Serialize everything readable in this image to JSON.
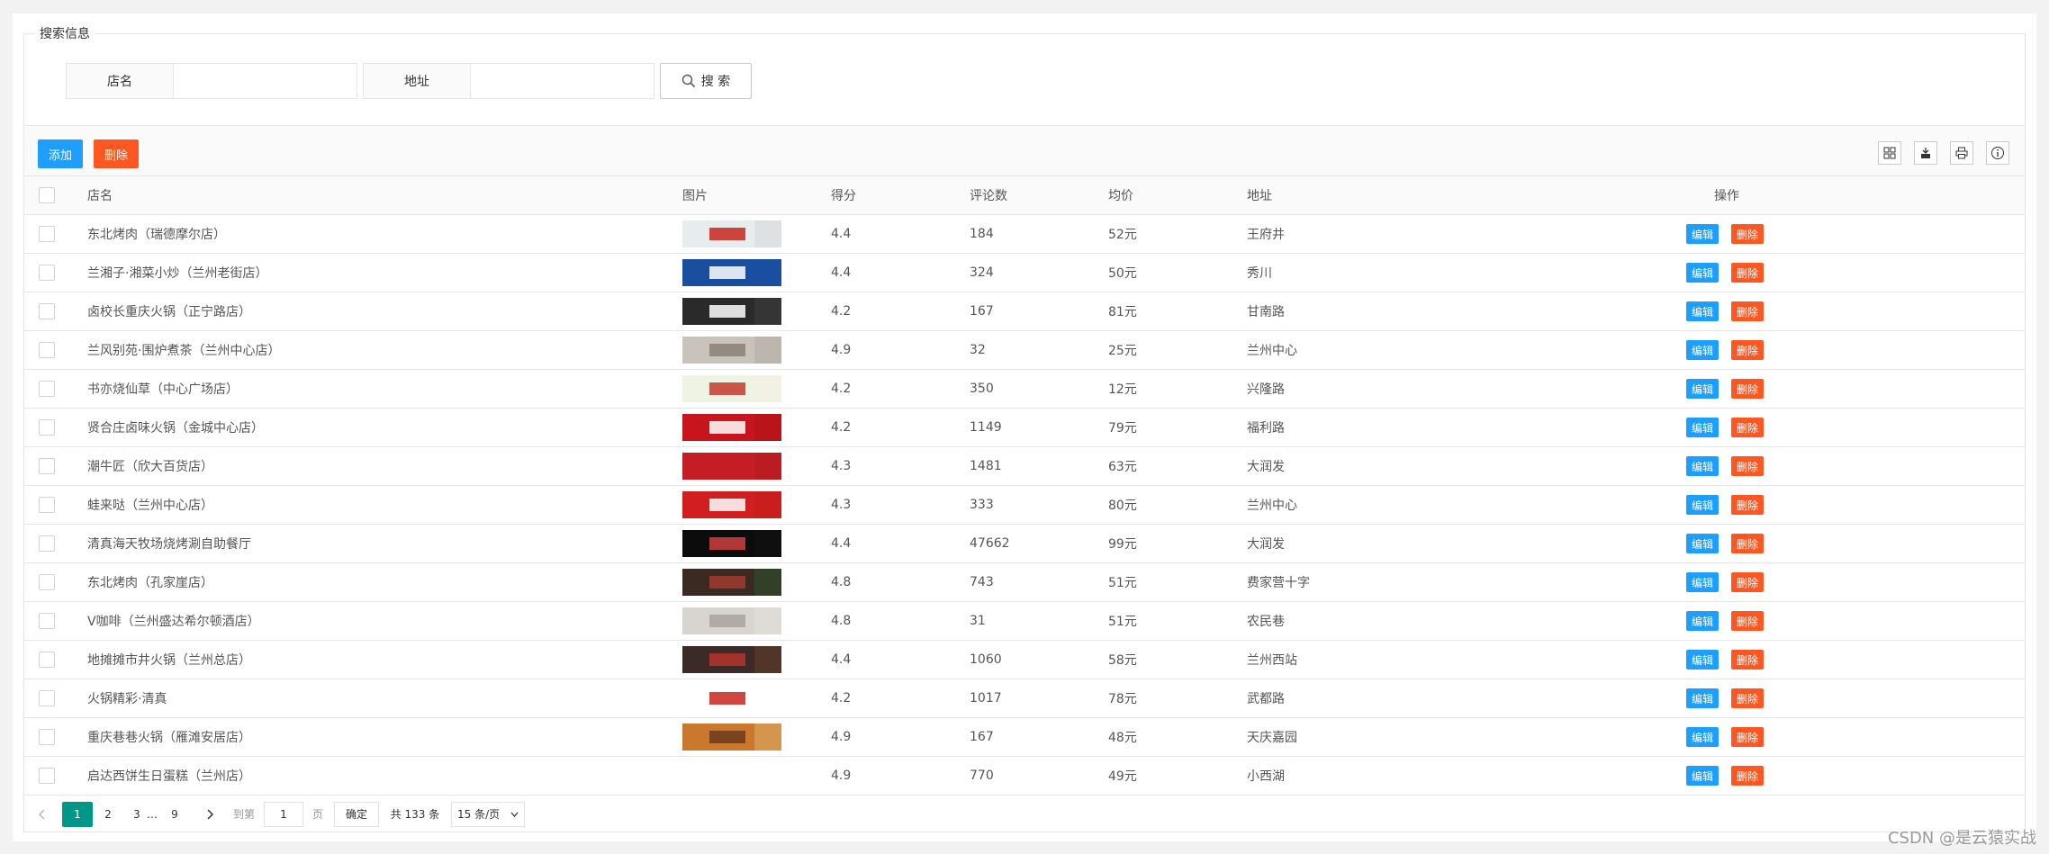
{
  "search": {
    "legend": "搜索信息",
    "name_label": "店名",
    "name_value": "",
    "address_label": "地址",
    "address_value": "",
    "search_button": "搜 索"
  },
  "toolbar": {
    "add_label": "添加",
    "delete_label": "删除",
    "icons": [
      "columns-icon",
      "export-icon",
      "print-icon",
      "info-icon"
    ]
  },
  "table": {
    "columns": [
      "店名",
      "图片",
      "得分",
      "评论数",
      "均价",
      "地址",
      "操作"
    ],
    "edit_label": "编辑",
    "delete_label": "删除",
    "rows": [
      {
        "name": "东北烤肉（瑞德摩尔店）",
        "score": "4.4",
        "reviews": "184",
        "price": "52元",
        "address": "王府井",
        "thumb": [
          "#e7ecef",
          "#c8261e",
          "#d9dde0"
        ]
      },
      {
        "name": "兰湘子·湘菜小炒（兰州老街店）",
        "score": "4.4",
        "reviews": "324",
        "price": "50元",
        "address": "秀川",
        "thumb": [
          "#1a4fa0",
          "#ffffff",
          "#1a4fa0"
        ]
      },
      {
        "name": "卤校长重庆火锅（正宁路店）",
        "score": "4.2",
        "reviews": "167",
        "price": "81元",
        "address": "甘南路",
        "thumb": [
          "#2a2a2a",
          "#ffffff",
          "#3a3a3a"
        ]
      },
      {
        "name": "兰风别苑·围炉煮茶（兰州中心店）",
        "score": "4.9",
        "reviews": "32",
        "price": "25元",
        "address": "兰州中心",
        "thumb": [
          "#c9c4bb",
          "#8a8174",
          "#b7b0a6"
        ]
      },
      {
        "name": "书亦烧仙草（中心广场店）",
        "score": "4.2",
        "reviews": "350",
        "price": "12元",
        "address": "兴隆路",
        "thumb": [
          "#eef3e4",
          "#c23a2e",
          "#f3efe3"
        ]
      },
      {
        "name": "贤合庄卤味火锅（金城中心店）",
        "score": "4.2",
        "reviews": "1149",
        "price": "79元",
        "address": "福利路",
        "thumb": [
          "#c8141c",
          "#ffffff",
          "#b3121a"
        ]
      },
      {
        "name": "潮牛匠（欣大百货店）",
        "score": "4.3",
        "reviews": "1481",
        "price": "63元",
        "address": "大润发",
        "thumb": [
          "#c41e24",
          "#c41e24",
          "#b81b21"
        ]
      },
      {
        "name": "蛙来哒（兰州中心店）",
        "score": "4.3",
        "reviews": "333",
        "price": "80元",
        "address": "兰州中心",
        "thumb": [
          "#d11f1f",
          "#ffffff",
          "#c81c1c"
        ]
      },
      {
        "name": "清真海天牧场烧烤涮自助餐厅",
        "score": "4.4",
        "reviews": "47662",
        "price": "99元",
        "address": "大润发",
        "thumb": [
          "#0c0c0c",
          "#d04040",
          "#111111"
        ]
      },
      {
        "name": "东北烤肉（孔家崖店）",
        "score": "4.8",
        "reviews": "743",
        "price": "51元",
        "address": "费家营十字",
        "thumb": [
          "#3a2a22",
          "#a23b2c",
          "#2e4a2a"
        ]
      },
      {
        "name": "V咖啡（兰州盛达希尔顿酒店）",
        "score": "4.8",
        "reviews": "31",
        "price": "51元",
        "address": "农民巷",
        "thumb": [
          "#d8d4cf",
          "#a9a39c",
          "#e3dfda"
        ]
      },
      {
        "name": "地摊摊市井火锅（兰州总店）",
        "score": "4.4",
        "reviews": "1060",
        "price": "58元",
        "address": "兰州西站",
        "thumb": [
          "#3b2a26",
          "#b6342d",
          "#5a3a2a"
        ]
      },
      {
        "name": "火锅精彩·清真",
        "score": "4.2",
        "reviews": "1017",
        "price": "78元",
        "address": "武都路",
        "thumb": [
          "#ffffff",
          "#c8261e",
          "#ffffff"
        ]
      },
      {
        "name": "重庆巷巷火锅（雁滩安居店）",
        "score": "4.9",
        "reviews": "167",
        "price": "48元",
        "address": "天庆嘉园",
        "thumb": [
          "#c9782e",
          "#6b3a1c",
          "#d9a25a"
        ]
      },
      {
        "name": "启达西饼生日蛋糕（兰州店）",
        "score": "4.9",
        "reviews": "770",
        "price": "49元",
        "address": "小西湖",
        "thumb": null
      }
    ]
  },
  "pager": {
    "pages": [
      "1",
      "2",
      "3",
      "…",
      "9"
    ],
    "current": "1",
    "goto_label": "到第",
    "goto_value": "1",
    "page_unit": "页",
    "confirm": "确定",
    "total": "共 133 条",
    "page_size": "15 条/页",
    "page_size_options": [
      "15 条/页"
    ]
  },
  "watermark": "CSDN @是云猿实战"
}
